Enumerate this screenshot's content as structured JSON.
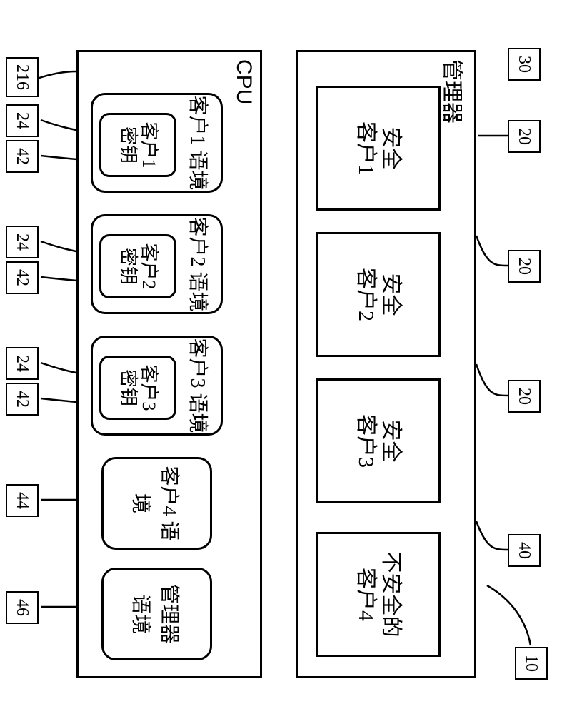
{
  "figure_ref": "10",
  "manager_container": {
    "label": "管理器",
    "ref": "30"
  },
  "clients": [
    {
      "label": "安全\n客户1",
      "ref": "20"
    },
    {
      "label": "安全\n客户2",
      "ref": "20"
    },
    {
      "label": "安全\n客户3",
      "ref": "20"
    },
    {
      "label": "不安全的\n客户4",
      "ref": "40"
    }
  ],
  "cpu_container": {
    "label": "CPU",
    "ref": "216"
  },
  "contexts": [
    {
      "label": "客户1 语境",
      "key_label": "客户1\n密钥",
      "ctx_ref": "42",
      "key_ref": "24"
    },
    {
      "label": "客户2 语境",
      "key_label": "客户2\n密钥",
      "ctx_ref": "42",
      "key_ref": "24"
    },
    {
      "label": "客户3 语境",
      "key_label": "客户3\n密钥",
      "ctx_ref": "42",
      "key_ref": "24"
    }
  ],
  "context4": {
    "label": "客户4 语境",
    "ref": "44"
  },
  "manager_context": {
    "label": "管理器\n语境",
    "ref": "46"
  }
}
